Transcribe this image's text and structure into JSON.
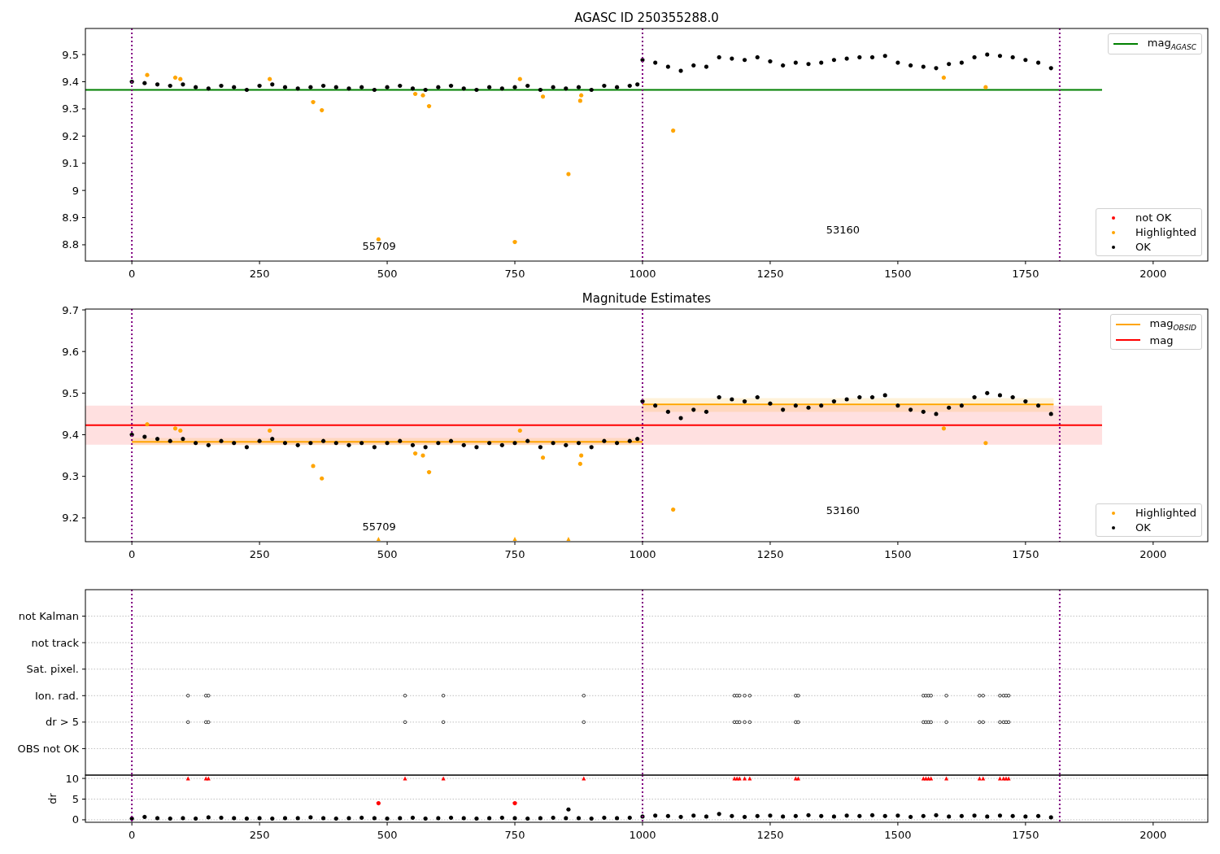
{
  "figure": {
    "panels": [
      {
        "kind": "plot",
        "legend_extra": [
          {
            "label": "not OK",
            "color": "#ff0000"
          }
        ],
        "chart_data": {
          "type": "scatter",
          "title": "AGASC ID 250355288.0",
          "xlim": [
            -91,
            2107
          ],
          "ylim": [
            8.74,
            9.596
          ],
          "xticks": [
            0,
            250,
            500,
            750,
            1000,
            1250,
            1500,
            1750,
            2000
          ],
          "yticks": [
            8.8,
            8.9,
            9.0,
            9.1,
            9.2,
            9.3,
            9.4,
            9.5
          ],
          "series": [
            {
              "name": "mag$_{AGASC}$",
              "color": "#008000",
              "type": "line",
              "x": [
                -91,
                1900
              ],
              "values": [
                9.37,
                9.37
              ]
            },
            {
              "name": "Highlighted",
              "color": "#ffa500",
              "type": "scatter",
              "x": [
                30,
                85,
                95,
                270,
                355,
                372,
                483,
                555,
                570,
                582,
                750,
                760,
                805,
                855,
                878,
                880,
                1060,
                1590,
                1672
              ],
              "values": [
                9.425,
                9.415,
                9.41,
                9.41,
                9.325,
                9.295,
                8.82,
                9.355,
                9.35,
                9.31,
                8.81,
                9.41,
                9.345,
                9.06,
                9.33,
                9.35,
                9.22,
                9.415,
                9.38
              ]
            },
            {
              "name": "OK",
              "color": "#000000",
              "type": "scatter",
              "x": [
                0,
                25,
                50,
                75,
                100,
                125,
                150,
                175,
                200,
                225,
                250,
                275,
                300,
                325,
                350,
                375,
                400,
                425,
                450,
                475,
                500,
                525,
                550,
                575,
                600,
                625,
                650,
                675,
                700,
                725,
                750,
                775,
                800,
                825,
                850,
                875,
                900,
                925,
                950,
                975,
                990,
                1000,
                1025,
                1050,
                1075,
                1100,
                1125,
                1150,
                1175,
                1200,
                1225,
                1250,
                1275,
                1300,
                1325,
                1350,
                1375,
                1400,
                1425,
                1450,
                1475,
                1500,
                1525,
                1550,
                1575,
                1600,
                1625,
                1650,
                1675,
                1700,
                1725,
                1750,
                1775,
                1800
              ],
              "values": [
                9.4,
                9.395,
                9.39,
                9.385,
                9.39,
                9.38,
                9.375,
                9.385,
                9.38,
                9.37,
                9.385,
                9.39,
                9.38,
                9.375,
                9.38,
                9.385,
                9.38,
                9.375,
                9.38,
                9.37,
                9.38,
                9.385,
                9.375,
                9.37,
                9.38,
                9.385,
                9.375,
                9.37,
                9.38,
                9.375,
                9.38,
                9.385,
                9.37,
                9.38,
                9.375,
                9.38,
                9.37,
                9.385,
                9.38,
                9.385,
                9.39,
                9.48,
                9.47,
                9.455,
                9.44,
                9.46,
                9.455,
                9.49,
                9.485,
                9.48,
                9.49,
                9.475,
                9.46,
                9.47,
                9.465,
                9.47,
                9.48,
                9.485,
                9.49,
                9.49,
                9.495,
                9.47,
                9.46,
                9.455,
                9.45,
                9.465,
                9.47,
                9.49,
                9.5,
                9.495,
                9.49,
                9.48,
                9.47,
                9.45
              ]
            }
          ],
          "ref_lines": [
            {
              "axis": "x",
              "value": 0
            },
            {
              "axis": "x",
              "value": 1000
            },
            {
              "axis": "x",
              "value": 1817
            }
          ],
          "annotations": [
            "55709",
            "53160"
          ]
        }
      },
      {
        "kind": "plot",
        "chart_data": {
          "type": "scatter",
          "title": "Magnitude Estimates",
          "xlim": [
            -91,
            2107
          ],
          "ylim": [
            9.143,
            9.702
          ],
          "xticks": [
            0,
            250,
            500,
            750,
            1000,
            1250,
            1500,
            1750,
            2000
          ],
          "yticks": [
            9.2,
            9.3,
            9.4,
            9.5,
            9.6,
            9.7
          ],
          "series": [
            {
              "name": "mag$_{OBSID}$",
              "color": "#ffa500",
              "type": "line",
              "x": [
                0,
                1000,
                null,
                1000,
                1805
              ],
              "values": [
                9.383,
                9.383,
                null,
                9.473,
                9.473
              ]
            },
            {
              "name": "mag",
              "color": "#ff0000",
              "type": "line",
              "x": [
                -91,
                1900
              ],
              "values": [
                9.423,
                9.423
              ]
            },
            {
              "name": "Highlighted",
              "color": "#ffa500",
              "type": "scatter",
              "x": [
                30,
                85,
                95,
                270,
                355,
                372,
                555,
                570,
                582,
                760,
                805,
                878,
                880,
                1060,
                1590,
                1672
              ],
              "values": [
                9.425,
                9.415,
                9.41,
                9.41,
                9.325,
                9.295,
                9.355,
                9.35,
                9.31,
                9.41,
                9.345,
                9.33,
                9.35,
                9.22,
                9.415,
                9.38
              ]
            },
            {
              "name": "OK",
              "color": "#000000",
              "type": "scatter",
              "x": [
                0,
                25,
                50,
                75,
                100,
                125,
                150,
                175,
                200,
                225,
                250,
                275,
                300,
                325,
                350,
                375,
                400,
                425,
                450,
                475,
                500,
                525,
                550,
                575,
                600,
                625,
                650,
                675,
                700,
                725,
                750,
                775,
                800,
                825,
                850,
                875,
                900,
                925,
                950,
                975,
                990,
                1000,
                1025,
                1050,
                1075,
                1100,
                1125,
                1150,
                1175,
                1200,
                1225,
                1250,
                1275,
                1300,
                1325,
                1350,
                1375,
                1400,
                1425,
                1450,
                1475,
                1500,
                1525,
                1550,
                1575,
                1600,
                1625,
                1650,
                1675,
                1700,
                1725,
                1750,
                1775,
                1800
              ],
              "values": [
                9.4,
                9.395,
                9.39,
                9.385,
                9.39,
                9.38,
                9.375,
                9.385,
                9.38,
                9.37,
                9.385,
                9.39,
                9.38,
                9.375,
                9.38,
                9.385,
                9.38,
                9.375,
                9.38,
                9.37,
                9.38,
                9.385,
                9.375,
                9.37,
                9.38,
                9.385,
                9.375,
                9.37,
                9.38,
                9.375,
                9.38,
                9.385,
                9.37,
                9.38,
                9.375,
                9.38,
                9.37,
                9.385,
                9.38,
                9.385,
                9.39,
                9.48,
                9.47,
                9.455,
                9.44,
                9.46,
                9.455,
                9.49,
                9.485,
                9.48,
                9.49,
                9.475,
                9.46,
                9.47,
                9.465,
                9.47,
                9.48,
                9.485,
                9.49,
                9.49,
                9.495,
                9.47,
                9.46,
                9.455,
                9.45,
                9.465,
                9.47,
                9.49,
                9.5,
                9.495,
                9.49,
                9.48,
                9.47,
                9.45
              ]
            },
            {
              "color": "#ffa500",
              "type": "scatter",
              "marker": "triangle",
              "x": [
                483,
                750,
                855
              ],
              "values": [
                9.15,
                9.15,
                9.15
              ]
            }
          ],
          "bands": [
            {
              "axis": "y",
              "from": 9.376,
              "to": 9.47,
              "color": "#ff0000"
            },
            {
              "axis": "y",
              "from": 9.375,
              "to": 9.392,
              "color": "#ffa500"
            },
            {
              "axis": "y",
              "from": 9.455,
              "to": 9.488,
              "color": "#ffa500"
            }
          ],
          "ref_lines": [
            {
              "axis": "x",
              "value": 0
            },
            {
              "axis": "x",
              "value": 1000
            },
            {
              "axis": "x",
              "value": 1817
            }
          ],
          "annotations": [
            "55709",
            "53160"
          ]
        }
      },
      {
        "kind": "flags",
        "rows": [
          {
            "label": "not Kalman",
            "marked": false
          },
          {
            "label": "not track",
            "marked": false
          },
          {
            "label": "Sat. pixel.",
            "marked": false
          },
          {
            "label": "Ion. rad.",
            "marked": true
          },
          {
            "label": "dr > 5",
            "marked": true
          },
          {
            "label": "OBS not OK",
            "marked": false
          }
        ]
      },
      {
        "kind": "plot",
        "chart_data": {
          "type": "scatter",
          "ylabel": "dr",
          "grid": true,
          "xlim": [
            -91,
            2107
          ],
          "ylim": [
            -0.6,
            10.8
          ],
          "xticks": [
            0,
            250,
            500,
            750,
            1000,
            1250,
            1500,
            1750,
            2000
          ],
          "yticks": [
            0,
            5,
            10
          ],
          "series": [
            {
              "color": "#000000",
              "type": "scatter",
              "x": [
                0,
                25,
                50,
                75,
                100,
                125,
                150,
                175,
                200,
                225,
                250,
                275,
                300,
                325,
                350,
                375,
                400,
                425,
                450,
                475,
                500,
                525,
                550,
                575,
                600,
                625,
                650,
                675,
                700,
                725,
                750,
                775,
                800,
                825,
                850,
                855,
                875,
                900,
                925,
                950,
                975,
                1000,
                1025,
                1050,
                1075,
                1100,
                1125,
                1150,
                1175,
                1200,
                1225,
                1250,
                1275,
                1300,
                1325,
                1350,
                1375,
                1400,
                1425,
                1450,
                1475,
                1500,
                1525,
                1550,
                1575,
                1600,
                1625,
                1650,
                1675,
                1700,
                1725,
                1750,
                1775,
                1800
              ],
              "values": [
                0.3,
                0.7,
                0.4,
                0.3,
                0.4,
                0.3,
                0.6,
                0.5,
                0.4,
                0.3,
                0.4,
                0.3,
                0.4,
                0.4,
                0.6,
                0.4,
                0.3,
                0.4,
                0.5,
                0.4,
                0.3,
                0.4,
                0.5,
                0.3,
                0.4,
                0.5,
                0.4,
                0.3,
                0.4,
                0.5,
                0.4,
                0.3,
                0.4,
                0.5,
                0.4,
                2.5,
                0.4,
                0.3,
                0.5,
                0.4,
                0.5,
                0.8,
                1.0,
                0.9,
                0.7,
                1.0,
                0.8,
                1.4,
                0.9,
                0.7,
                0.9,
                1.0,
                0.8,
                0.9,
                1.1,
                0.9,
                0.8,
                1.0,
                0.9,
                1.1,
                0.9,
                1.0,
                0.7,
                0.9,
                1.1,
                0.8,
                0.9,
                1.0,
                0.8,
                1.0,
                0.9,
                0.8,
                0.9,
                0.6
              ]
            },
            {
              "color": "#ff0000",
              "type": "scatter",
              "marker": "triangle",
              "x": [
                110,
                145,
                150,
                535,
                610,
                885,
                1180,
                1185,
                1190,
                1200,
                1210,
                1300,
                1305,
                1550,
                1555,
                1560,
                1565,
                1595,
                1660,
                1667,
                1700,
                1707,
                1712,
                1717
              ],
              "values": [
                10,
                10,
                10,
                10,
                10,
                10,
                10,
                10,
                10,
                10,
                10,
                10,
                10,
                10,
                10,
                10,
                10,
                10,
                10,
                10,
                10,
                10,
                10,
                10
              ]
            },
            {
              "color": "#ff0000",
              "type": "scatter",
              "x": [
                483,
                750
              ],
              "values": [
                4,
                4
              ]
            }
          ],
          "ref_lines": [
            {
              "axis": "x",
              "value": 0
            },
            {
              "axis": "x",
              "value": 1000
            },
            {
              "axis": "x",
              "value": 1817
            }
          ]
        }
      }
    ]
  }
}
